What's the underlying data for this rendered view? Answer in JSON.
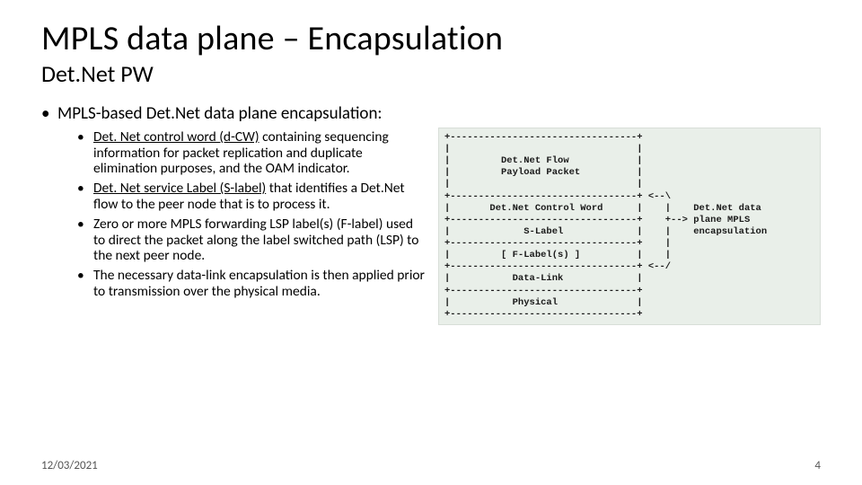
{
  "title": "MPLS data plane – Encapsulation",
  "subtitle": "Det.Net PW",
  "main_bullet": "MPLS-based Det.Net data plane encapsulation:",
  "sub_bullets": [
    {
      "lead": "Det. Net control word (d-CW)",
      "rest": " containing sequencing information for packet replication and duplicate elimination purposes, and the OAM indicator."
    },
    {
      "lead": "Det. Net service Label (S-label)",
      "rest": " that identifies a Det.Net flow to the peer node that is to process it."
    },
    {
      "lead": "Zero or more MPLS forwarding LSP label(s) (F-label)",
      "rest": " used to direct the packet along the label switched path (LSP) to the next peer node."
    },
    {
      "lead": "The necessary data-link encapsulation",
      "rest": " is then applied prior to transmission over the physical media."
    }
  ],
  "diagram": "+---------------------------------+\n|                                 |\n|         Det.Net Flow            |\n|         Payload Packet          |\n|                                 |\n+---------------------------------+ <--\\\n|       Det.Net Control Word      |    |    Det.Net data\n+---------------------------------+    +--> plane MPLS\n|             S-Label             |    |    encapsulation\n+---------------------------------+    |\n|         [ F-Label(s) ]          |    |\n+---------------------------------+ <--/\n|           Data-Link             |\n+---------------------------------+\n|           Physical              |\n+---------------------------------+",
  "footer": {
    "date": "12/03/2021",
    "page": "4"
  }
}
